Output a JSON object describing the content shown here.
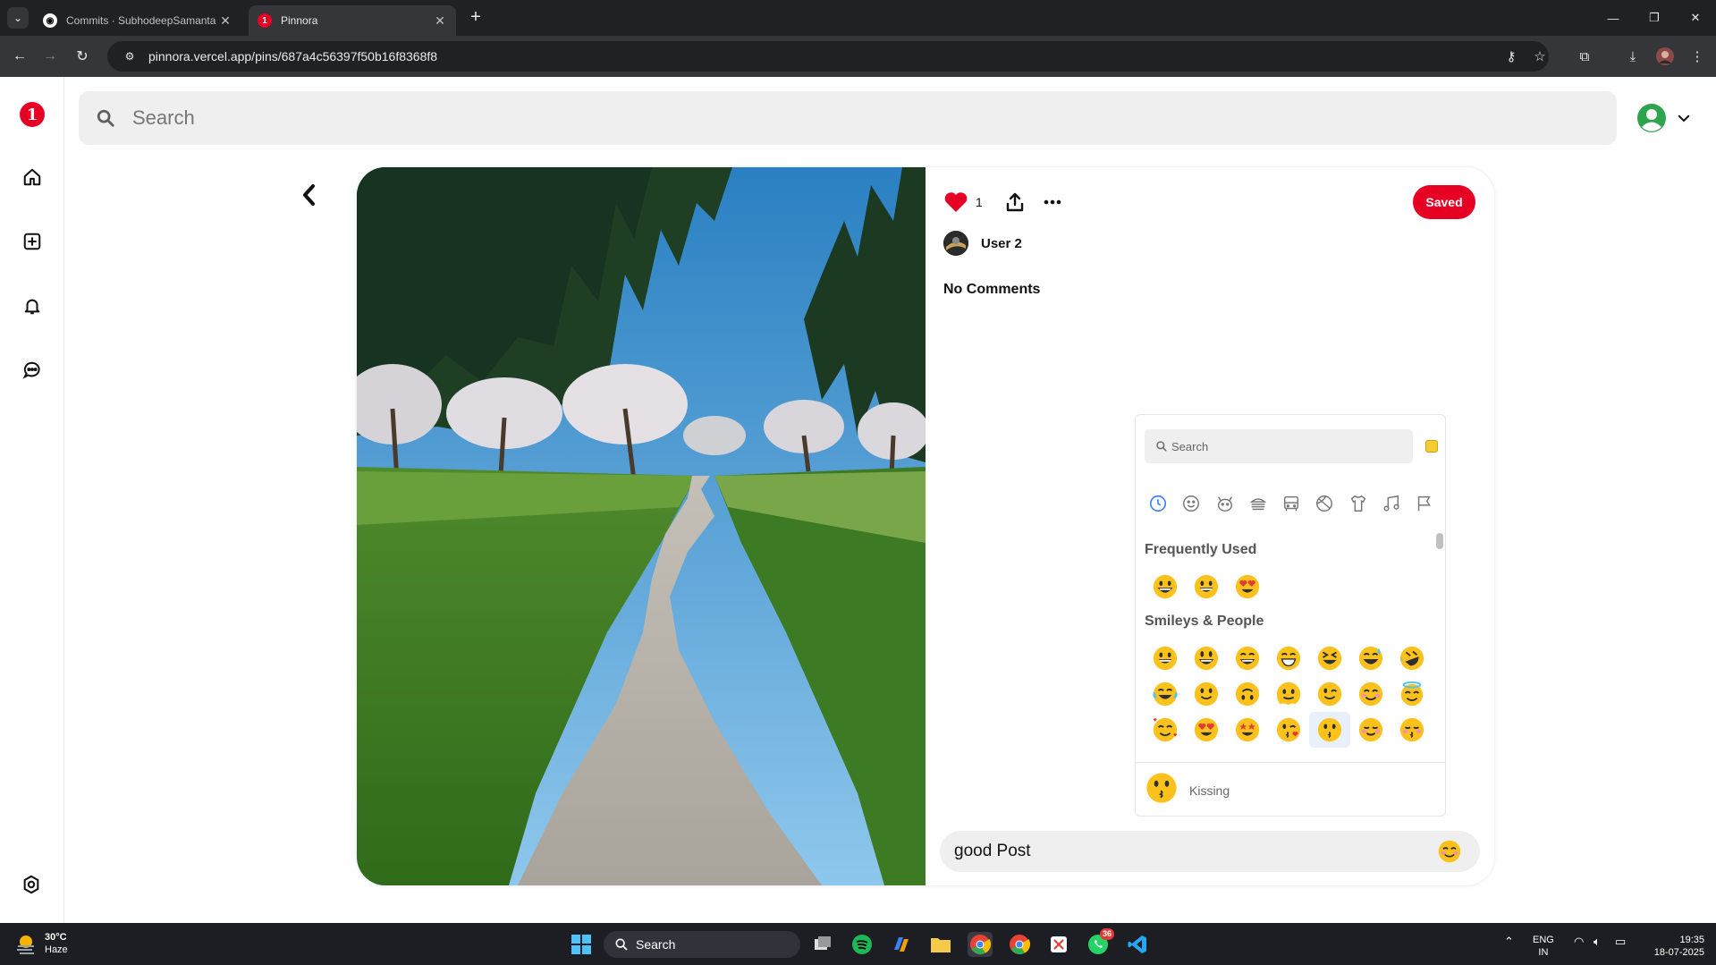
{
  "browser": {
    "tabs": [
      {
        "title": "Commits · SubhodeepSamanta",
        "active": false
      },
      {
        "title": "Pinnora",
        "active": true
      }
    ],
    "url": "pinnora.vercel.app/pins/687a4c56397f50b16f8368f8"
  },
  "app": {
    "logo_letter": "1",
    "search_placeholder": "Search",
    "sidebar_icons": [
      "home-icon",
      "create-icon",
      "bell-icon",
      "chat-icon",
      "settings-icon"
    ],
    "colors": {
      "brand": "#e60023",
      "surface": "#efefef"
    }
  },
  "pin": {
    "like_count": "1",
    "saved_label": "Saved",
    "author": "User 2",
    "comments_title": "No Comments",
    "comment_value": "good Post"
  },
  "emoji_picker": {
    "search_placeholder": "Search",
    "categories": [
      "recent-icon",
      "smiley-icon",
      "animal-icon",
      "food-icon",
      "travel-icon",
      "activity-icon",
      "objects-icon",
      "symbols-icon",
      "flags-icon"
    ],
    "frequent_title": "Frequently Used",
    "smileys_title": "Smileys & People",
    "preview_label": "Kissing"
  },
  "taskbar": {
    "temp": "30°C",
    "condition": "Haze",
    "search_label": "Search",
    "whatsapp_badge": "36",
    "lang_line1": "ENG",
    "lang_line2": "IN",
    "time": "19:35",
    "date": "18-07-2025"
  }
}
